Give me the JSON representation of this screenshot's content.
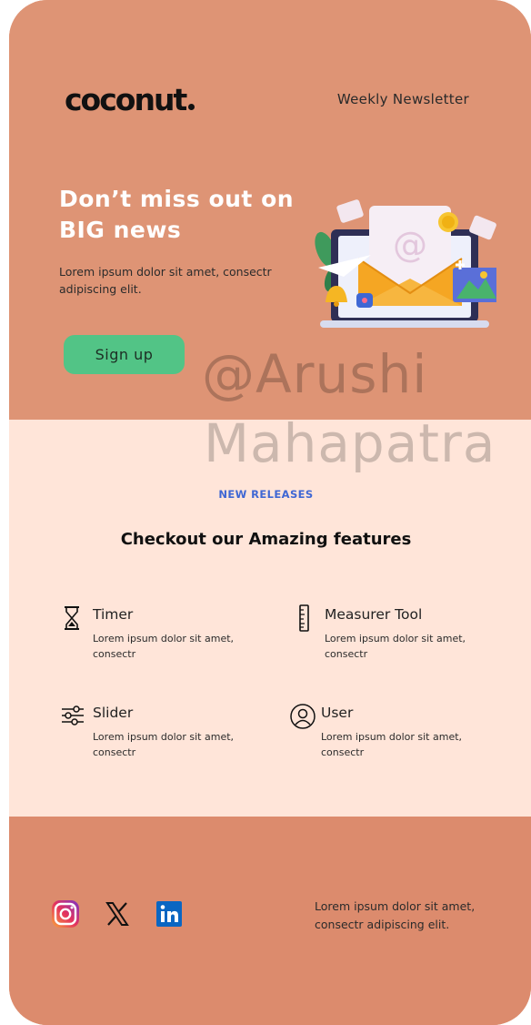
{
  "header": {
    "logo_text": "coconut",
    "newsletter_label": "Weekly Newsletter"
  },
  "hero": {
    "headline": "Don’t miss out on BIG news",
    "description": "Lorem ipsum dolor sit amet, consectr adipiscing elit.",
    "signup_label": "Sign up"
  },
  "watermark": {
    "line1": "@Arushi",
    "line2": "Mahapatra"
  },
  "features": {
    "label": "NEW RELEASES",
    "title": "Checkout our Amazing features",
    "items": [
      {
        "title": "Timer",
        "description": "Lorem ipsum dolor sit amet, consectr",
        "icon": "hourglass-icon"
      },
      {
        "title": "Measurer Tool",
        "description": "Lorem ipsum dolor sit amet, consectr",
        "icon": "ruler-icon"
      },
      {
        "title": "Slider",
        "description": "Lorem ipsum dolor sit amet, consectr",
        "icon": "sliders-icon"
      },
      {
        "title": "User",
        "description": "Lorem ipsum dolor sit amet, consectr",
        "icon": "user-icon"
      }
    ]
  },
  "footer": {
    "social": [
      "instagram-icon",
      "x-icon",
      "linkedin-icon"
    ],
    "text": "Lorem ipsum dolor sit amet, consectr adipiscing elit."
  },
  "colors": {
    "hero_bg": "#de9475",
    "features_bg": "#ffe5d9",
    "footer_bg": "#dc8b6d",
    "accent_green": "#52c486",
    "accent_blue": "#3f67d4"
  }
}
